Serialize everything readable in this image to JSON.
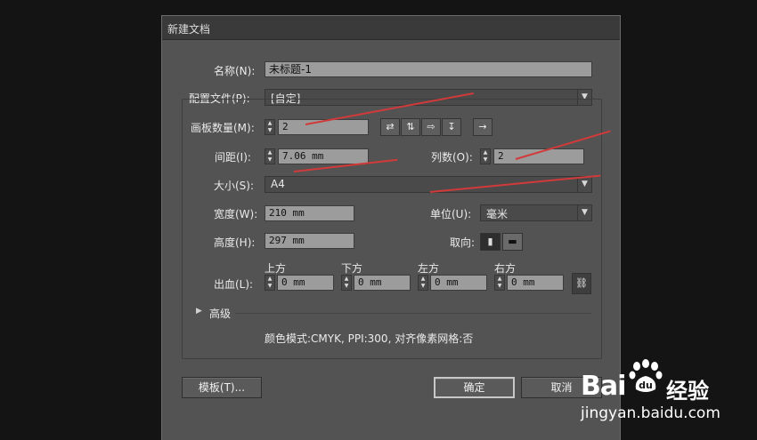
{
  "dialog": {
    "title": "新建文档",
    "name_label": "名称(N):",
    "name_value": "未标题-1",
    "profile_label": "配置文件(P):",
    "profile_value": "[自定]",
    "artboards_label": "画板数量(M):",
    "artboards_value": "2",
    "spacing_label": "间距(I):",
    "spacing_value": "7.06 mm",
    "columns_label": "列数(O):",
    "columns_value": "2",
    "size_label": "大小(S):",
    "size_value": "A4",
    "width_label": "宽度(W):",
    "width_value": "210 mm",
    "units_label": "单位(U):",
    "units_value": "毫米",
    "height_label": "高度(H):",
    "height_value": "297 mm",
    "orientation_label": "取向:",
    "bleed_label": "出血(L):",
    "bleed_top_label": "上方",
    "bleed_bottom_label": "下方",
    "bleed_left_label": "左方",
    "bleed_right_label": "右方",
    "bleed_top_value": "0 mm",
    "bleed_bottom_value": "0 mm",
    "bleed_left_value": "0 mm",
    "bleed_right_value": "0 mm",
    "advanced_label": "高级",
    "info_text": "颜色模式:CMYK, PPI:300, 对齐像素网格:否",
    "template_button": "模板(T)...",
    "ok_button": "确定",
    "cancel_button": "取消"
  },
  "watermark": {
    "brand": "Bai",
    "brand2": "du",
    "cn": "经验",
    "url": "jingyan.baidu.com"
  },
  "colors": {
    "dialog_bg": "#535353",
    "annotation_red": "#d23a3a"
  }
}
